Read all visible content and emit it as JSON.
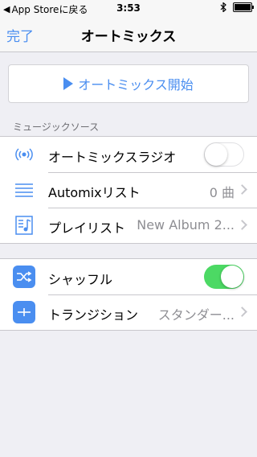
{
  "status_bar": {
    "back_app": "App Storeに戻る",
    "time": "3:53"
  },
  "nav": {
    "done": "完了",
    "title": "オートミックス"
  },
  "start_button": {
    "label": "オートミックス開始"
  },
  "music_source": {
    "header": "ミュージックソース",
    "items": [
      {
        "label": "オートミックスラジオ",
        "toggle": false,
        "icon": "radio-waves-icon"
      },
      {
        "label": "Automixリスト",
        "value": "0 曲",
        "icon": "list-icon"
      },
      {
        "label": "プレイリスト",
        "value": "New Album 2...",
        "icon": "playlist-icon"
      }
    ]
  },
  "settings": {
    "items": [
      {
        "label": "シャッフル",
        "toggle": true,
        "icon": "shuffle-icon"
      },
      {
        "label": "トランジション",
        "value": "スタンダー...",
        "icon": "transition-icon"
      }
    ]
  },
  "colors": {
    "accent": "#4a8ef0",
    "toggle_on": "#4cd964"
  }
}
